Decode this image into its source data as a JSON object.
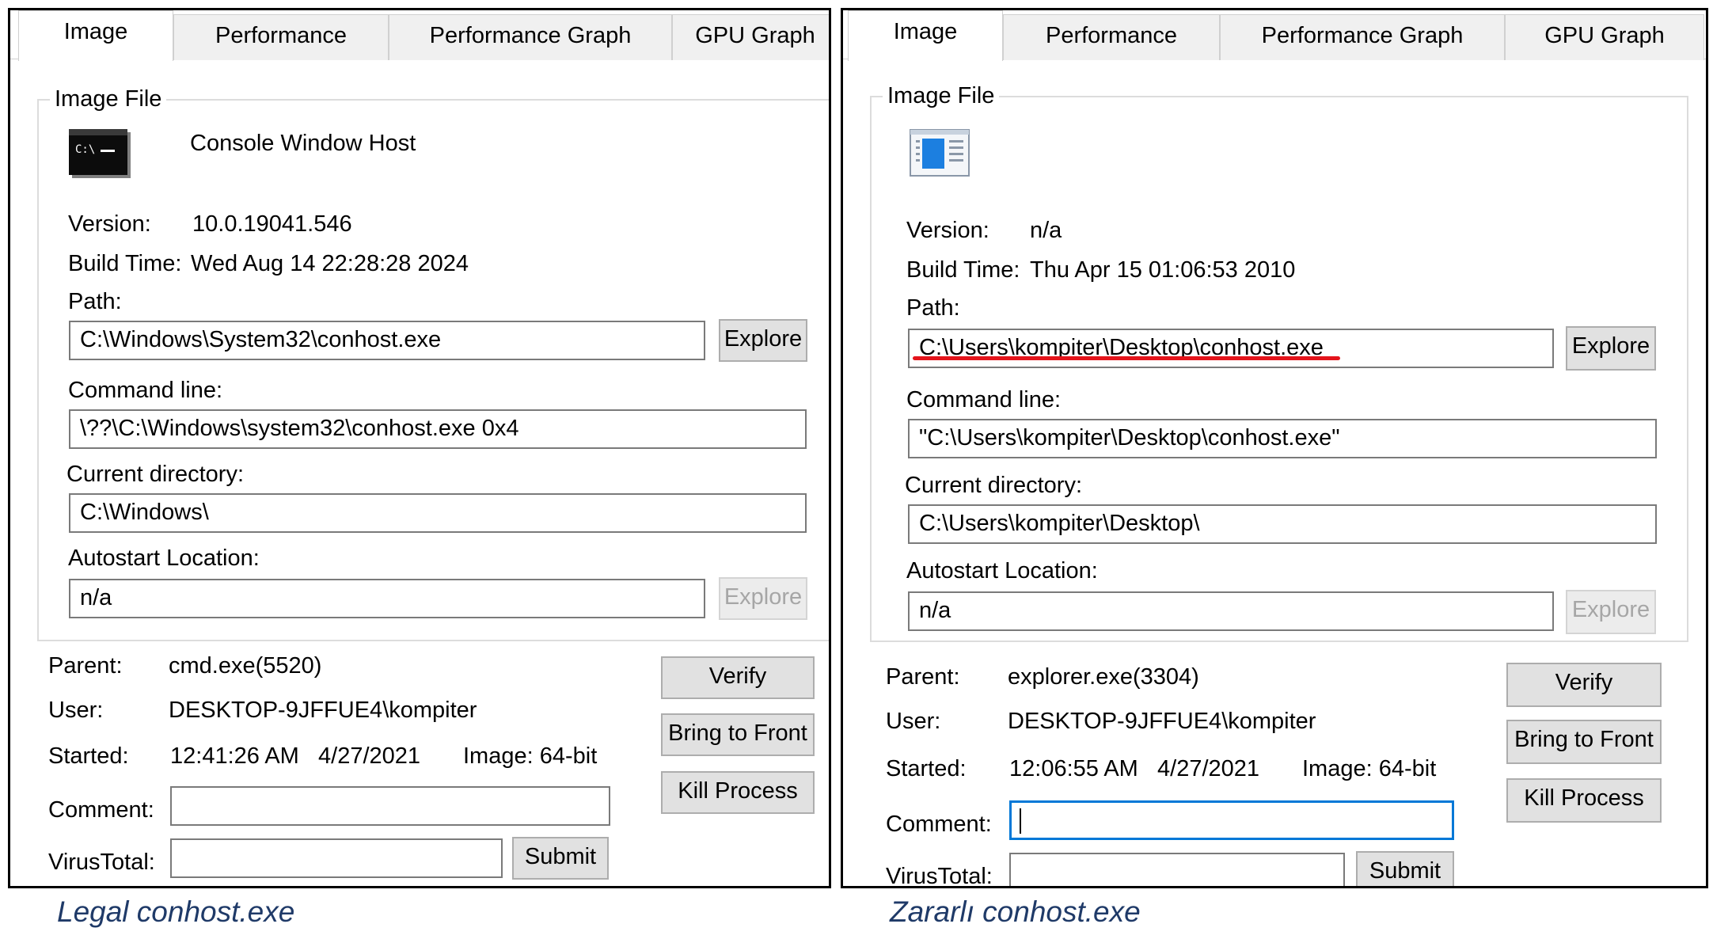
{
  "left": {
    "tabs": [
      "Image",
      "Performance",
      "Performance Graph",
      "GPU Graph"
    ],
    "group_title": "Image File",
    "icon": "console-window-icon",
    "description": "Console Window Host",
    "version_label": "Version:",
    "version": "10.0.19041.546",
    "build_label": "Build Time:",
    "build_time": "Wed Aug 14 22:28:28 2024",
    "path_label": "Path:",
    "path": "C:\\Windows\\System32\\conhost.exe",
    "explore_label": "Explore",
    "cmd_label": "Command line:",
    "cmd": "\\??\\C:\\Windows\\system32\\conhost.exe 0x4",
    "curdir_label": "Current directory:",
    "curdir": "C:\\Windows\\",
    "autostart_label": "Autostart Location:",
    "autostart": "n/a",
    "parent_label": "Parent:",
    "parent": "cmd.exe(5520)",
    "user_label": "User:",
    "user": "DESKTOP-9JFFUE4\\kompiter",
    "started_label": "Started:",
    "started": "12:41:26 AM   4/27/2021",
    "image_bits": "Image: 64-bit",
    "comment_label": "Comment:",
    "comment": "",
    "virustotal_label": "VirusTotal:",
    "virustotal": "",
    "verify_label": "Verify",
    "bring_label": "Bring to Front",
    "kill_label": "Kill Process",
    "submit_label": "Submit"
  },
  "right": {
    "tabs": [
      "Image",
      "Performance",
      "Performance Graph",
      "GPU Graph"
    ],
    "group_title": "Image File",
    "icon": "generic-application-icon",
    "version_label": "Version:",
    "version": "n/a",
    "build_label": "Build Time:",
    "build_time": "Thu Apr 15 01:06:53 2010",
    "path_label": "Path:",
    "path": "C:\\Users\\kompiter\\Desktop\\conhost.exe",
    "explore_label": "Explore",
    "cmd_label": "Command line:",
    "cmd": "\"C:\\Users\\kompiter\\Desktop\\conhost.exe\"",
    "curdir_label": "Current directory:",
    "curdir": "C:\\Users\\kompiter\\Desktop\\",
    "autostart_label": "Autostart Location:",
    "autostart": "n/a",
    "parent_label": "Parent:",
    "parent": "explorer.exe(3304)",
    "user_label": "User:",
    "user": "DESKTOP-9JFFUE4\\kompiter",
    "started_label": "Started:",
    "started": "12:06:55 AM   4/27/2021",
    "image_bits": "Image: 64-bit",
    "comment_label": "Comment:",
    "comment": "",
    "virustotal_label": "VirusTotal:",
    "virustotal": "",
    "verify_label": "Verify",
    "bring_label": "Bring to Front",
    "kill_label": "Kill Process",
    "submit_label": "Submit"
  },
  "captions": {
    "left": "Legal conhost.exe",
    "right": "Zararlı conhost.exe"
  },
  "colors": {
    "highlight_underline": "#e4141b",
    "focus_border": "#0078d7",
    "caption_text": "#1f3a68"
  }
}
